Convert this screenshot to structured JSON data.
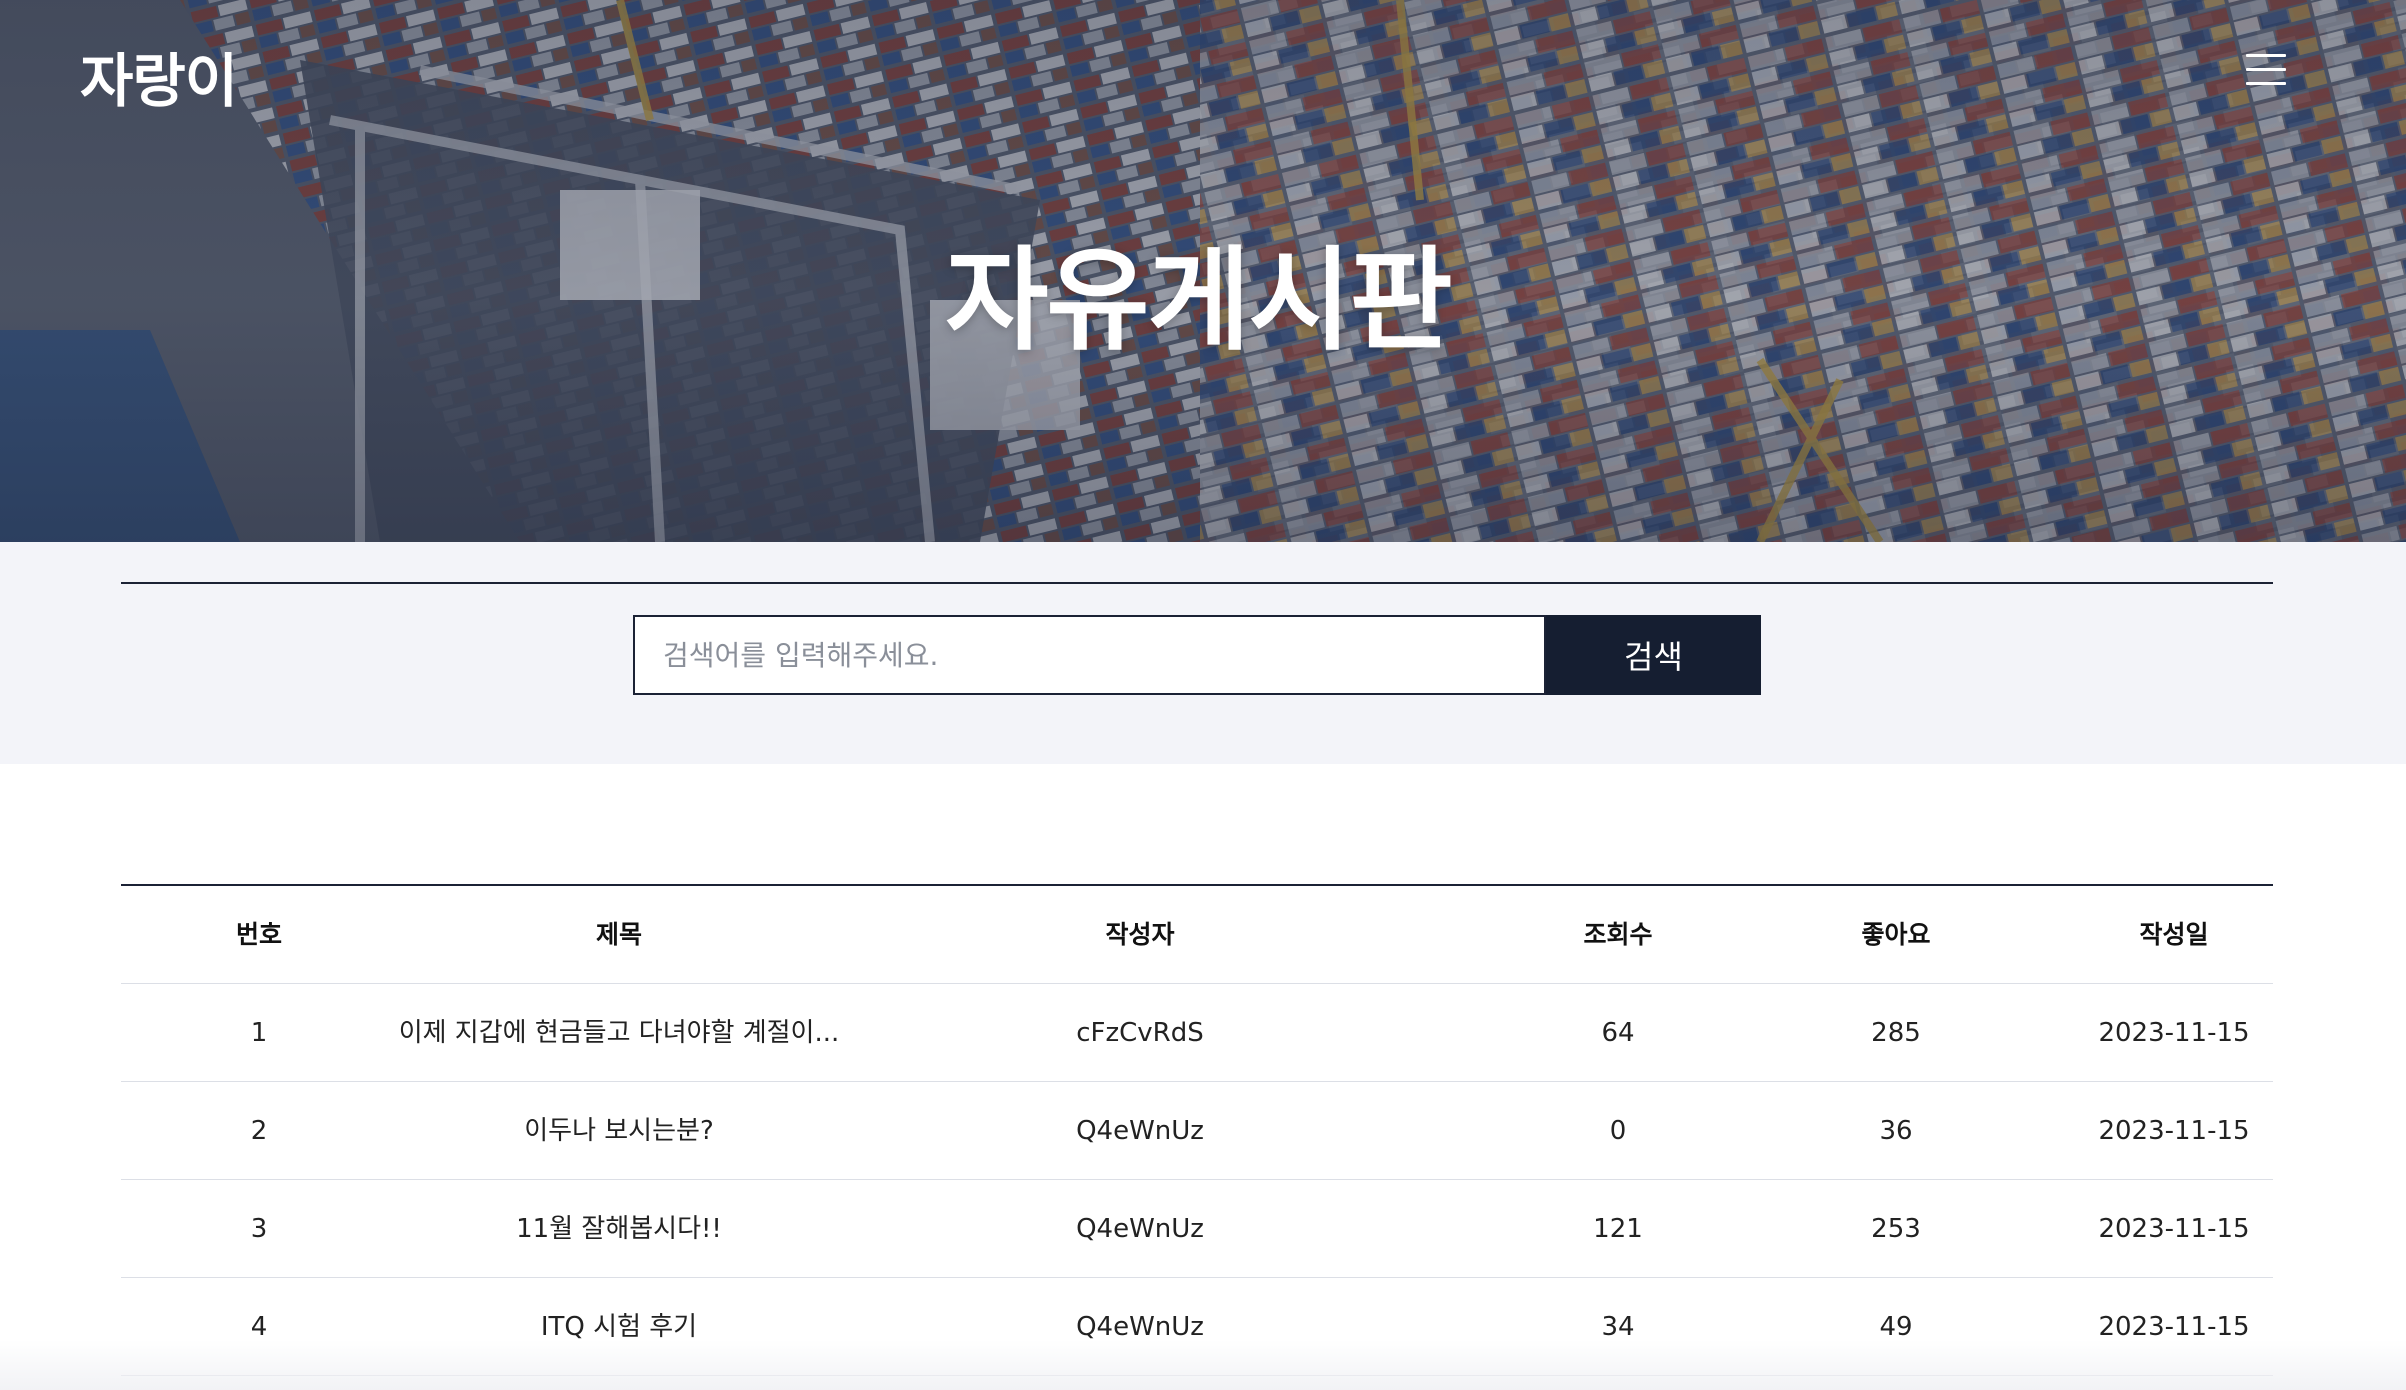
{
  "header": {
    "logo": "자랑이",
    "menu_icon": "hamburger-menu-icon",
    "title": "자유게시판"
  },
  "search": {
    "placeholder": "검색어를 입력해주세요.",
    "button_label": "검색"
  },
  "board": {
    "columns": [
      "번호",
      "제목",
      "작성자",
      "조회수",
      "좋아요",
      "작성일"
    ],
    "rows": [
      {
        "no": "1",
        "title": "이제 지갑에 현금들고 다녀야할 계절이...",
        "author": "cFzCvRdS",
        "views": "64",
        "likes": "285",
        "date": "2023-11-15"
      },
      {
        "no": "2",
        "title": "이두나 보시는분?",
        "author": "Q4eWnUz",
        "views": "0",
        "likes": "36",
        "date": "2023-11-15"
      },
      {
        "no": "3",
        "title": "11월 잘해봅시다!!",
        "author": "Q4eWnUz",
        "views": "121",
        "likes": "253",
        "date": "2023-11-15"
      },
      {
        "no": "4",
        "title": "ITQ 시험 후기",
        "author": "Q4eWnUz",
        "views": "34",
        "likes": "49",
        "date": "2023-11-15"
      }
    ]
  },
  "colors": {
    "navy": "#151e31",
    "band": "#f3f4f9"
  }
}
